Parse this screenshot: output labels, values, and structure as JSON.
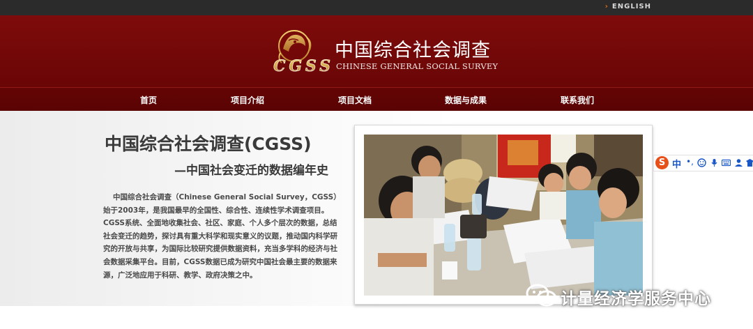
{
  "topbar": {
    "lang_link": "ENGLISH"
  },
  "header": {
    "logo_mark": "CGSS",
    "title_cn": "中国综合社会调查",
    "title_en": "CHINESE GENERAL SOCIAL SURVEY"
  },
  "nav": {
    "items": [
      {
        "label": "首页"
      },
      {
        "label": "项目介绍"
      },
      {
        "label": "项目文档"
      },
      {
        "label": "数据与成果"
      },
      {
        "label": "联系我们"
      }
    ]
  },
  "hero": {
    "title": "中国综合社会调查(CGSS)",
    "subtitle": "—中国社会变迁的数据编年史",
    "body": "中国综合社会调查（Chinese General Social Survey，CGSS）始于2003年，是我国最早的全国性、综合性、连续性学术调查项目。CGSS系统、全面地收集社会、社区、家庭、个人多个层次的数据，总结社会变迁的趋势，探讨具有重大科学和现实意义的议题，推动国内科学研究的开放与共享，为国际比较研究提供数据资料，充当多学科的经济与社会数据采集平台。目前，CGSS数据已成为研究中国社会最主要的数据来源，广泛地应用于科研、教学、政府决策之中。"
  },
  "ime_toolbar": {
    "logo": "S",
    "mode": "中",
    "punct": "•,"
  },
  "watermark": {
    "text": "计量经济学服务中心"
  },
  "colors": {
    "header_red": "#7e0b0b",
    "nav_red": "#5e0303",
    "top_bar": "#2b2b2b",
    "accent_orange": "#e06a1a",
    "logo_gold": "#d9a441"
  }
}
